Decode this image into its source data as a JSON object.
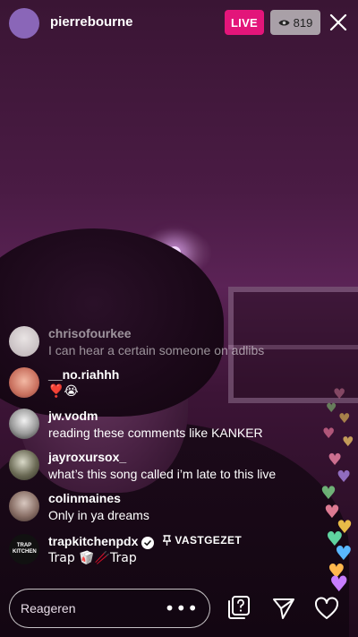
{
  "header": {
    "host_username": "pierrebourne",
    "live_label": "LIVE",
    "viewer_count": "819"
  },
  "comments": [
    {
      "username": "chrisofourkee",
      "text": "I can hear a certain someone on adlibs"
    },
    {
      "username": "__no.riahhh",
      "text": "❣️😭"
    },
    {
      "username": "jw.vodm",
      "text": "reading these comments like KANKER"
    },
    {
      "username": "jayroxursox_",
      "text": "what’s this song called i’m late to this live"
    },
    {
      "username": "colinmaines",
      "text": "Only in ya dreams"
    },
    {
      "username": "trapkitchenpdx",
      "text": "Trap 🥡🥢Trap",
      "pinned_label": "VASTGEZET",
      "verified": true,
      "avatar_text": "TRAP KITCHEN"
    }
  ],
  "bottom_bar": {
    "reply_placeholder": "Reageren",
    "more_label": "•••"
  },
  "colors": {
    "live": "#e3157a",
    "viewer_badge": "#c8c8c8",
    "host_avatar": "#8a66b8"
  }
}
